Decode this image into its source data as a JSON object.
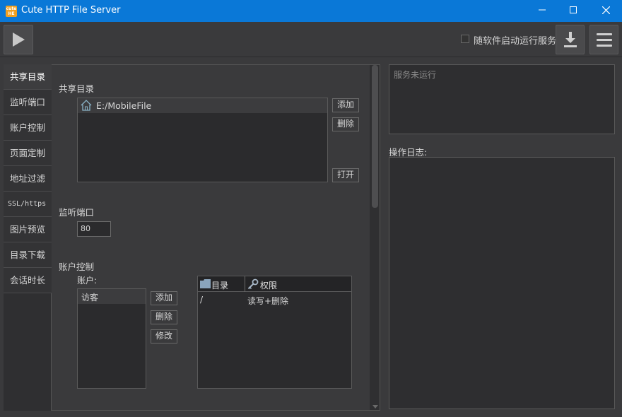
{
  "window": {
    "title": "Cute HTTP File Server",
    "icon_text": "cute\nHE"
  },
  "toolbar": {
    "autostart_label": "随软件启动运行服务"
  },
  "nav": {
    "items": [
      {
        "label": "共享目录"
      },
      {
        "label": "监听端口"
      },
      {
        "label": "账户控制"
      },
      {
        "label": "页面定制"
      },
      {
        "label": "地址过滤"
      },
      {
        "label": "SSL/https"
      },
      {
        "label": "图片预览"
      },
      {
        "label": "目录下载"
      },
      {
        "label": "会话时长"
      }
    ]
  },
  "shared_dir": {
    "title": "共享目录",
    "entries": [
      "E:/MobileFile"
    ],
    "add_label": "添加",
    "delete_label": "删除",
    "open_label": "打开"
  },
  "port": {
    "title": "监听端口",
    "value": "80"
  },
  "accounts": {
    "title": "账户控制",
    "accounts_label": "账户:",
    "list": [
      "访客"
    ],
    "add_label": "添加",
    "delete_label": "删除",
    "edit_label": "修改",
    "table": {
      "col_dir": "目录",
      "col_perm": "权限",
      "rows": [
        {
          "dir": "/",
          "perm": "读写+删除"
        }
      ]
    }
  },
  "status": {
    "text": "服务未运行"
  },
  "log": {
    "label": "操作日志:"
  }
}
